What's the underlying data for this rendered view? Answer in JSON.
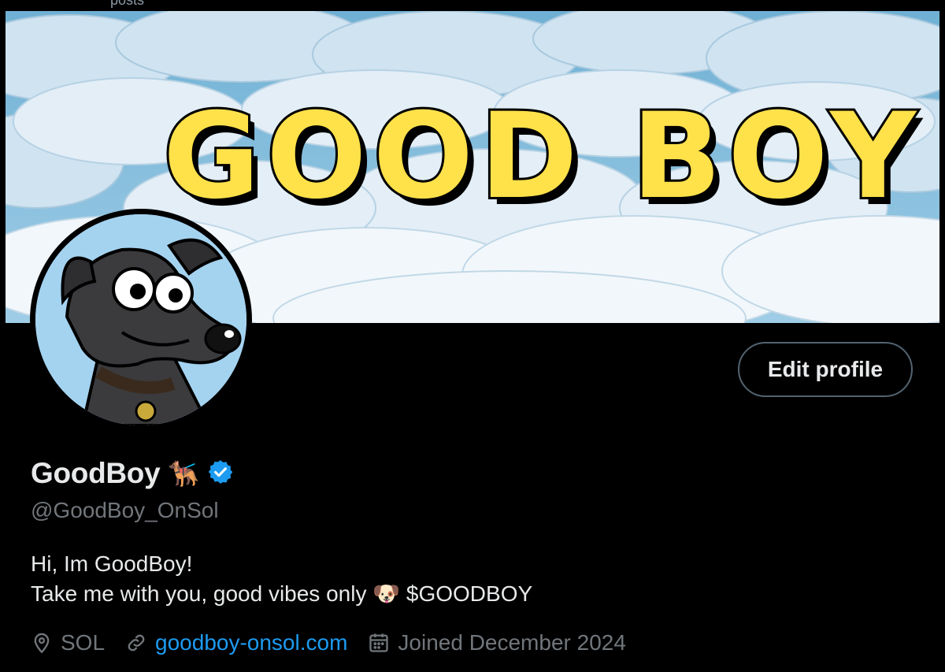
{
  "top_strip": {
    "faint_text": "posts"
  },
  "banner": {
    "title_art": "GOOD BOY"
  },
  "profile": {
    "edit_button_label": "Edit profile",
    "display_name": "GoodBoy",
    "name_emoji": "🐕‍🦺",
    "handle": "@GoodBoy_OnSol",
    "bio_line_1": "Hi, Im GoodBoy!",
    "bio_line_2_prefix": "Take me with you, good vibes only",
    "bio_line_2_emoji": "🐶",
    "bio_line_2_suffix": "$GOODBOY",
    "location": "SOL",
    "website": "goodboy-onsol.com",
    "joined": "Joined December 2024"
  },
  "icons": {
    "verified": "verified-badge-icon",
    "location": "location-pin-icon",
    "link": "link-icon",
    "calendar": "calendar-icon"
  },
  "colors": {
    "accent": "#1d9bf0",
    "secondary_text": "#71767b",
    "primary_text": "#e7e9ea",
    "background": "#000000",
    "button_border": "#536471"
  }
}
